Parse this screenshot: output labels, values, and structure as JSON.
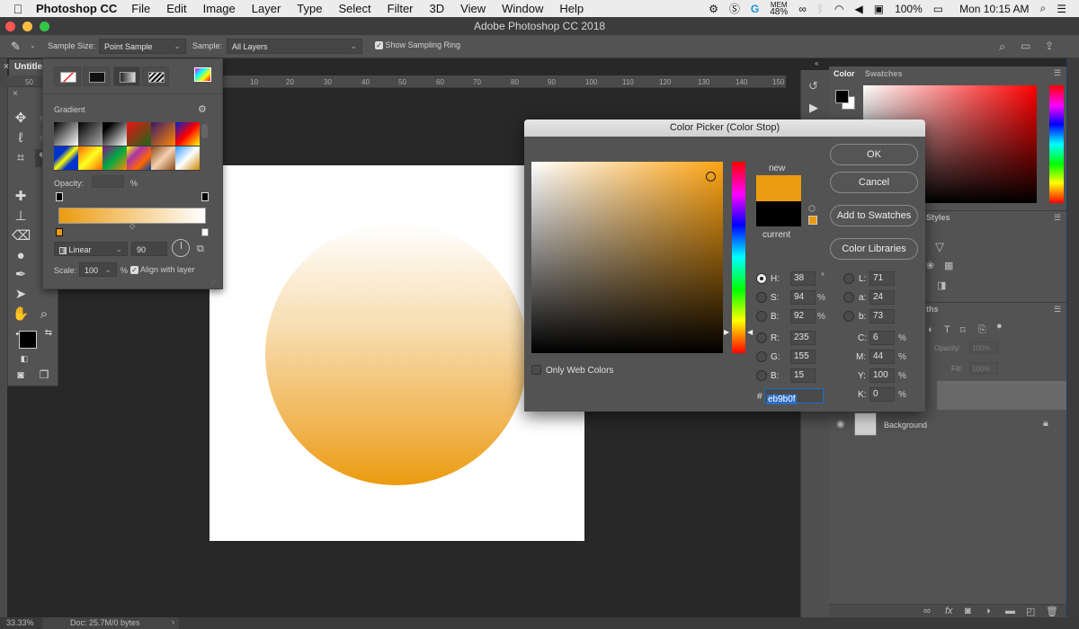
{
  "menubar": {
    "apple": "",
    "app_name": "Photoshop CC",
    "items": [
      "File",
      "Edit",
      "Image",
      "Layer",
      "Type",
      "Select",
      "Filter",
      "3D",
      "View",
      "Window",
      "Help"
    ],
    "status": {
      "mem_label": "MEM",
      "mem_value": "48%",
      "battery": "100%",
      "clock": "Mon 10:15 AM"
    }
  },
  "window": {
    "title": "Adobe Photoshop CC 2018"
  },
  "options_bar": {
    "sample_size_label": "Sample Size:",
    "sample_size_value": "Point Sample",
    "sample_label": "Sample:",
    "sample_value": "All Layers",
    "show_sampling_ring_label": "Show Sampling Ring",
    "show_sampling_ring_checked": true
  },
  "document": {
    "tab_title": "Untitle",
    "ruler_ticks": [
      "50",
      "10",
      "20",
      "30",
      "40",
      "50",
      "60",
      "70",
      "80",
      "90",
      "100",
      "110",
      "120",
      "130",
      "140",
      "150"
    ]
  },
  "gradient_popup": {
    "section_label": "Gradient",
    "opacity_label": "Opacity:",
    "opacity_value": "",
    "percent": "%",
    "type_value": "Linear",
    "angle_value": "90",
    "scale_label": "Scale:",
    "scale_value": "100",
    "align_label": "Align with layer",
    "align_checked": true,
    "start_color": "#eb9b0f",
    "end_color": "#ffffff"
  },
  "color_picker": {
    "title": "Color Picker (Color Stop)",
    "new_label": "new",
    "current_label": "current",
    "new_color": "#eb9b0f",
    "current_color": "#000000",
    "buttons": {
      "ok": "OK",
      "cancel": "Cancel",
      "add_swatches": "Add to Swatches",
      "libraries": "Color Libraries"
    },
    "only_web_colors": "Only Web Colors",
    "hsb": [
      {
        "label": "H:",
        "value": "38",
        "unit": "°",
        "selected": true
      },
      {
        "label": "S:",
        "value": "94",
        "unit": "%",
        "selected": false
      },
      {
        "label": "B:",
        "value": "92",
        "unit": "%",
        "selected": false
      }
    ],
    "rgb": [
      {
        "label": "R:",
        "value": "235"
      },
      {
        "label": "G:",
        "value": "155"
      },
      {
        "label": "B:",
        "value": "15"
      }
    ],
    "lab": [
      {
        "label": "L:",
        "value": "71"
      },
      {
        "label": "a:",
        "value": "24"
      },
      {
        "label": "b:",
        "value": "73"
      }
    ],
    "cmyk": [
      {
        "label": "C:",
        "value": "6",
        "unit": "%"
      },
      {
        "label": "M:",
        "value": "44",
        "unit": "%"
      },
      {
        "label": "Y:",
        "value": "100",
        "unit": "%"
      },
      {
        "label": "K:",
        "value": "0",
        "unit": "%"
      }
    ],
    "hex_label": "#",
    "hex_value": "eb9b0f"
  },
  "panels": {
    "color_tab": "Color",
    "swatches_tab": "Swatches",
    "styles_tab": "Styles",
    "paths_tab": "ths",
    "opacity_label": "Opacity:",
    "opacity_value": "100%",
    "fill_label": "Fill:",
    "fill_value": "100%",
    "layers": [
      {
        "name": "Background",
        "locked": true,
        "visible": true
      }
    ]
  },
  "status_bar": {
    "zoom": "33.33%",
    "doc_info": "Doc: 25.7M/0 bytes",
    "arrow": "›"
  }
}
